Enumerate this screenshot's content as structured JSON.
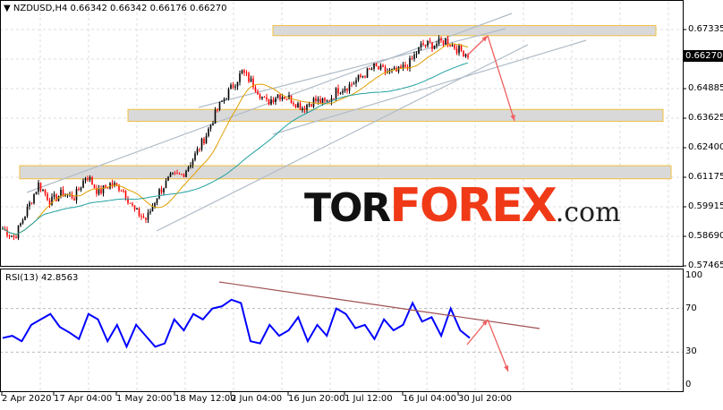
{
  "header": {
    "title": "▼ NZDUSD,H4  0.66342 0.66342 0.66176 0.66270"
  },
  "rsi_header": {
    "title": "RSI(13) 42.8563"
  },
  "current_price": "0.66270",
  "logo": {
    "part1": "TOR",
    "part2": "FOREX",
    "part3": ".com"
  },
  "colors": {
    "up": "#000000",
    "down": "#ff0000",
    "ma_fast": "#e0a000",
    "ma_slow": "#20a0a0",
    "rsi": "#0000ff",
    "zone_fill": "#d9d9d9",
    "zone_border": "#f0c040",
    "channel": "#b0bcc8",
    "arrow": "#f06060",
    "rsi_trend": "#a05050"
  },
  "chart_data": [
    {
      "type": "candlestick",
      "title": "NZDUSD,H4",
      "ylim": [
        0.57465,
        0.67335
      ],
      "yticks": [
        "0.67335",
        "0.66110",
        "0.64885",
        "0.63625",
        "0.62400",
        "0.61175",
        "0.59915",
        "0.58690",
        "0.57465"
      ],
      "xticks": [
        "2 Apr 2020",
        "17 Apr 04:00",
        "1 May 20:00",
        "18 May 12:00",
        "2 Jun 04:00",
        "16 Jun 20:00",
        "1 Jul 12:00",
        "16 Jul 04:00",
        "30 Jul 20:00"
      ],
      "close": [
        0.5902,
        0.5865,
        0.5977,
        0.6089,
        0.6014,
        0.6052,
        0.6033,
        0.6127,
        0.6052,
        0.6089,
        0.607,
        0.5977,
        0.5939,
        0.6052,
        0.6115,
        0.6127,
        0.6202,
        0.6295,
        0.6408,
        0.6483,
        0.6557,
        0.6501,
        0.6426,
        0.6464,
        0.6445,
        0.6408,
        0.6438,
        0.6426,
        0.6483,
        0.6501,
        0.6539,
        0.6576,
        0.6557,
        0.6557,
        0.6595,
        0.667,
        0.667,
        0.6689,
        0.6651,
        0.6627
      ],
      "zones": [
        [
          0.6708,
          0.675
        ],
        [
          0.635,
          0.64
        ],
        [
          0.611,
          0.6165
        ]
      ]
    },
    {
      "type": "line",
      "title": "RSI(13)",
      "ylim": [
        0,
        100
      ],
      "yticks": [
        "100",
        "70",
        "30",
        "0"
      ],
      "values": [
        43,
        45,
        40,
        55,
        60,
        65,
        53,
        48,
        42,
        65,
        60,
        40,
        55,
        35,
        55,
        45,
        35,
        38,
        60,
        50,
        65,
        60,
        70,
        72,
        78,
        75,
        40,
        38,
        55,
        45,
        50,
        62,
        40,
        55,
        45,
        70,
        65,
        52,
        55,
        42,
        60,
        50,
        55,
        75,
        58,
        62,
        45,
        70,
        50,
        43
      ]
    }
  ]
}
